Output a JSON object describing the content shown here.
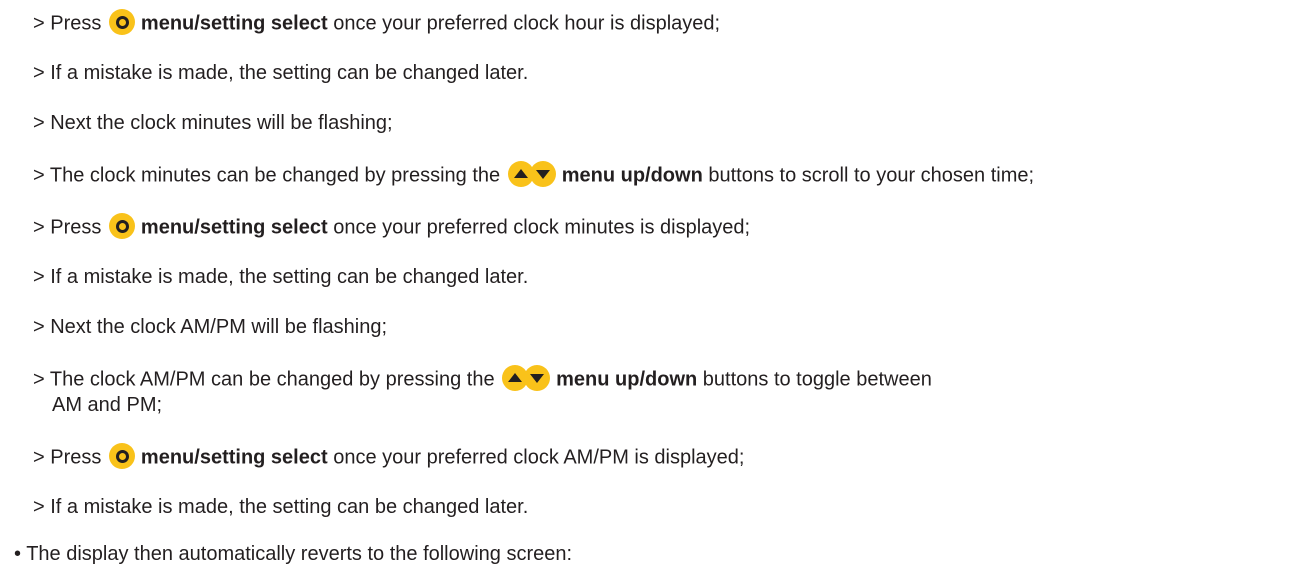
{
  "lines": [
    {
      "prefix": "> Press ",
      "bold": "menu/setting select",
      "suffix": " once your preferred clock hour is displayed;"
    },
    {
      "text": "> If a mistake is made, the setting can be changed later."
    },
    {
      "text": "> Next the clock minutes will be flashing;"
    },
    {
      "prefix": "> The clock minutes can be changed by pressing the ",
      "bold": "menu up/down",
      "suffix": " buttons to scroll to your chosen time;"
    },
    {
      "prefix": "> Press ",
      "bold": "menu/setting select",
      "suffix": " once your preferred clock minutes is displayed;"
    },
    {
      "text": "> If a mistake is made, the setting can be changed later."
    },
    {
      "text": "> Next the clock AM/PM will be flashing;"
    },
    {
      "prefix": "> The clock AM/PM can be changed by pressing the ",
      "bold": "menu up/down",
      "suffix": " buttons to toggle between",
      "continuation": "AM and PM;"
    },
    {
      "prefix": "> Press ",
      "bold": "menu/setting select",
      "suffix": " once your preferred clock AM/PM is displayed;"
    },
    {
      "text": "> If a mistake is made, the setting can be changed later."
    }
  ],
  "bullet": "• The display then automatically reverts to the following screen:",
  "icons": {
    "select": "select-button-icon",
    "updown": "up-down-buttons-icon"
  },
  "colors": {
    "icon_fill": "#f9c21a",
    "text": "#231f20"
  }
}
